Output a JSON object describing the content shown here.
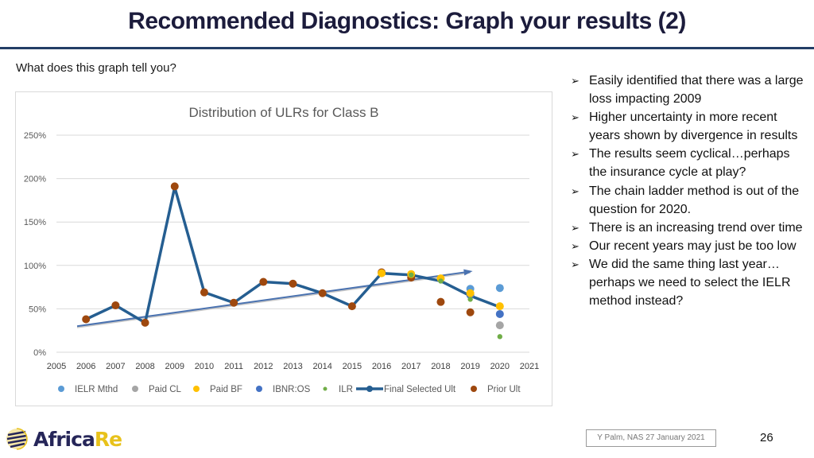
{
  "slide": {
    "title": "Recommended Diagnostics: Graph your results (2)",
    "question": "What does this graph tell you?",
    "bullets": [
      "Easily identified that there was a large loss impacting 2009",
      "Higher uncertainty in more recent years shown by divergence in results",
      "The results seem cyclical…perhaps the insurance cycle at play?",
      "The chain ladder method is out of the question for 2020.",
      "There is an increasing trend over time",
      "Our recent years may just be too low",
      "We did the same thing last year…perhaps we need to select the IELR method instead?"
    ],
    "bullet_icon": "arrow-bullet-icon",
    "bullet_glyph": "➢",
    "footer": "Y Palm, NAS 27 January 2021",
    "page_number": "26",
    "logo": {
      "part1": "Africa",
      "part2": "Re",
      "icon": "globe-stripes-icon"
    },
    "colors": {
      "title": "#1c1c3c",
      "rule": "#233e66",
      "logo_navy": "#262659",
      "logo_gold": "#e8c21b"
    }
  },
  "chart_data": {
    "type": "line",
    "title": "Distribution of ULRs for Class B",
    "xlabel": "",
    "ylabel": "",
    "xlim": [
      2005,
      2021
    ],
    "ylim": [
      0,
      250
    ],
    "x_ticks": [
      "2005",
      "2006",
      "2007",
      "2008",
      "2009",
      "2010",
      "2011",
      "2012",
      "2013",
      "2014",
      "2015",
      "2016",
      "2017",
      "2018",
      "2019",
      "2020",
      "2021"
    ],
    "y_ticks": [
      "0%",
      "50%",
      "100%",
      "150%",
      "200%",
      "250%"
    ],
    "y_tick_values": [
      0,
      50,
      100,
      150,
      200,
      250
    ],
    "grid": true,
    "legend": "bottom",
    "series": [
      {
        "name": "IELR Mthd",
        "kind": "scatter",
        "color": "#5b9bd5",
        "x": [
          2019,
          2020
        ],
        "values": [
          73,
          74
        ]
      },
      {
        "name": "Paid CL",
        "kind": "scatter",
        "color": "#a5a5a5",
        "x": [
          2020
        ],
        "values": [
          31
        ]
      },
      {
        "name": "Paid BF",
        "kind": "scatter",
        "color": "#ffc000",
        "x": [
          2016,
          2017,
          2018,
          2019,
          2020
        ],
        "values": [
          91,
          90,
          85,
          68,
          53
        ]
      },
      {
        "name": "IBNR:OS",
        "kind": "scatter",
        "color": "#4472c4",
        "x": [
          2019,
          2020
        ],
        "values": [
          66,
          44
        ]
      },
      {
        "name": "ILR",
        "kind": "scatter",
        "color": "#70ad47",
        "x": [
          2017,
          2018,
          2019,
          2020
        ],
        "values": [
          89,
          82,
          61,
          18
        ]
      },
      {
        "name": "Final Selected Ult",
        "kind": "line",
        "color": "#255e91",
        "x": [
          2006,
          2007,
          2008,
          2009,
          2010,
          2011,
          2012,
          2013,
          2014,
          2015,
          2016,
          2017,
          2018,
          2019,
          2020
        ],
        "values": [
          38,
          54,
          34,
          190,
          69,
          57,
          81,
          79,
          68,
          53,
          91,
          89,
          82,
          65,
          52
        ]
      },
      {
        "name": "Prior Ult",
        "kind": "scatter",
        "color": "#9e480e",
        "x": [
          2006,
          2007,
          2008,
          2009,
          2010,
          2011,
          2012,
          2013,
          2014,
          2015,
          2016,
          2017,
          2018,
          2019
        ],
        "values": [
          38,
          54,
          34,
          191,
          69,
          57,
          81,
          79,
          68,
          53,
          92,
          86,
          58,
          46
        ]
      }
    ],
    "annotations": [
      {
        "type": "trend-arrow",
        "color": "#4a72b0",
        "from": [
          2005.7,
          30
        ],
        "to": [
          2019.0,
          93
        ]
      }
    ]
  }
}
